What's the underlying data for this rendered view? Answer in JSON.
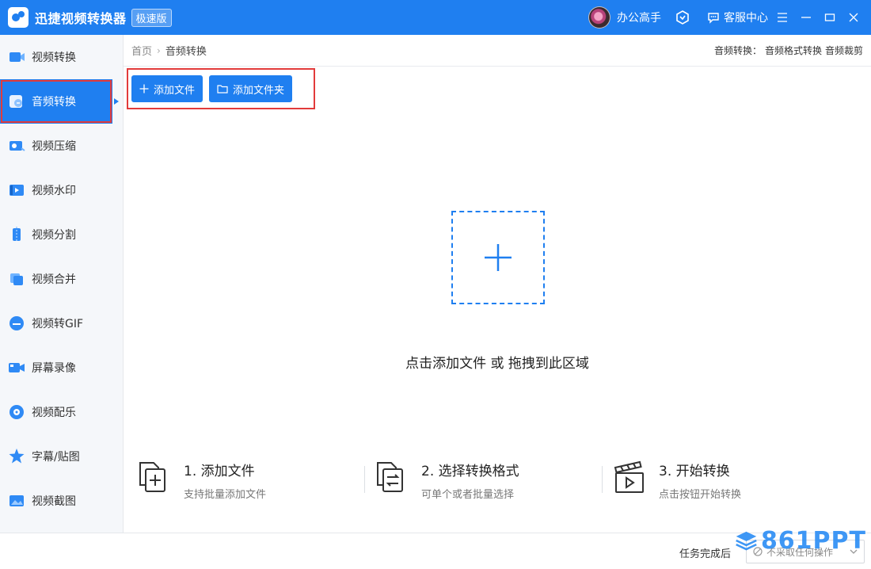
{
  "app": {
    "title": "迅捷视频转换器",
    "badge": "极速版",
    "user_name": "办公高手",
    "service_label": "客服中心"
  },
  "sidebar": {
    "items": [
      {
        "label": "视频转换",
        "icon": "video-convert-icon"
      },
      {
        "label": "音频转换",
        "icon": "audio-convert-icon",
        "active": true
      },
      {
        "label": "视频压缩",
        "icon": "video-compress-icon"
      },
      {
        "label": "视频水印",
        "icon": "video-watermark-icon"
      },
      {
        "label": "视频分割",
        "icon": "video-split-icon"
      },
      {
        "label": "视频合并",
        "icon": "video-merge-icon"
      },
      {
        "label": "视频转GIF",
        "icon": "video-gif-icon"
      },
      {
        "label": "屏幕录像",
        "icon": "screen-record-icon"
      },
      {
        "label": "视频配乐",
        "icon": "video-music-icon"
      },
      {
        "label": "字幕/贴图",
        "icon": "subtitle-sticker-icon"
      },
      {
        "label": "视频截图",
        "icon": "video-screenshot-icon"
      }
    ]
  },
  "breadcrumb": {
    "home": "首页",
    "current": "音频转换"
  },
  "header_right": {
    "prefix": "音频转换：",
    "link1": "音频格式转换",
    "link2": "音频裁剪"
  },
  "toolbar": {
    "add_file": "添加文件",
    "add_folder": "添加文件夹"
  },
  "dropzone": {
    "hint": "点击添加文件 或 拖拽到此区域"
  },
  "steps": [
    {
      "title": "1. 添加文件",
      "sub": "支持批量添加文件"
    },
    {
      "title": "2. 选择转换格式",
      "sub": "可单个或者批量选择"
    },
    {
      "title": "3. 开始转换",
      "sub": "点击按钮开始转换"
    }
  ],
  "footer": {
    "after_label": "任务完成后",
    "after_value": "不采取任何操作"
  },
  "watermark": "861PPT",
  "colors": {
    "accent": "#1f7ff0",
    "highlight_border": "#e23b3b"
  }
}
